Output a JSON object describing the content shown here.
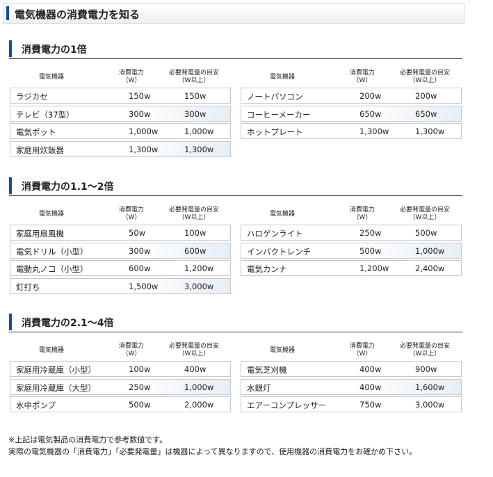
{
  "header": {
    "title": "電気機器の消費電力を知る"
  },
  "columns": {
    "device": "電気機器",
    "power": "消費電力",
    "power_unit": "（W）",
    "required": "必要発電量の目安",
    "required_unit": "（W以上）"
  },
  "sections": [
    {
      "title": "消費電力の1倍",
      "left": [
        {
          "name": "ラジカセ",
          "power": "150w",
          "req": "150w"
        },
        {
          "name": "テレビ（37型）",
          "power": "300w",
          "req": "300w"
        },
        {
          "name": "電気ポット",
          "power": "1,000w",
          "req": "1,000w"
        },
        {
          "name": "家庭用炊飯器",
          "power": "1,300w",
          "req": "1,300w"
        }
      ],
      "right": [
        {
          "name": "ノートパソコン",
          "power": "200w",
          "req": "200w"
        },
        {
          "name": "コーヒーメーカー",
          "power": "650w",
          "req": "650w"
        },
        {
          "name": "ホットプレート",
          "power": "1,300w",
          "req": "1,300w"
        }
      ]
    },
    {
      "title": "消費電力の1.1〜2倍",
      "left": [
        {
          "name": "家庭用扇風機",
          "power": "50w",
          "req": "100w"
        },
        {
          "name": "電気ドリル（小型）",
          "power": "300w",
          "req": "600w"
        },
        {
          "name": "電動丸ノコ（小型）",
          "power": "600w",
          "req": "1,200w"
        },
        {
          "name": "釘打ち",
          "power": "1,500w",
          "req": "3,000w"
        }
      ],
      "right": [
        {
          "name": "ハロゲンライト",
          "power": "250w",
          "req": "500w"
        },
        {
          "name": "インパクトレンチ",
          "power": "500w",
          "req": "1,000w"
        },
        {
          "name": "電気カンナ",
          "power": "1,200w",
          "req": "2,400w"
        }
      ]
    },
    {
      "title": "消費電力の2.1〜4倍",
      "left": [
        {
          "name": "家庭用冷蔵庫（小型）",
          "power": "100w",
          "req": "400w"
        },
        {
          "name": "家庭用冷蔵庫（大型）",
          "power": "250w",
          "req": "1,000w"
        },
        {
          "name": "水中ポンプ",
          "power": "500w",
          "req": "2,000w"
        }
      ],
      "right": [
        {
          "name": "電気芝刈機",
          "power": "400w",
          "req": "900w"
        },
        {
          "name": "水銀灯",
          "power": "400w",
          "req": "1,600w"
        },
        {
          "name": "エアーコンプレッサー",
          "power": "750w",
          "req": "3,000w"
        }
      ]
    }
  ],
  "notes": [
    "※上記は電気製品の消費電力で参考数値です。",
    "実際の電気機器の「消費電力」「必要発電量」は機器によって異なりますので、使用機器の消費電力をお確かめ下さい。"
  ]
}
